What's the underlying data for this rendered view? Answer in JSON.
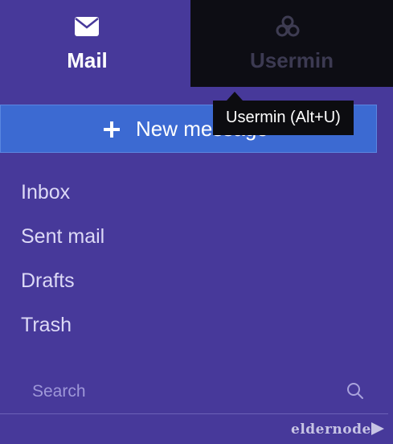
{
  "tabs": {
    "mail": {
      "label": "Mail",
      "icon": "envelope-icon"
    },
    "usermin": {
      "label": "Usermin",
      "icon": "usermin-logo-icon"
    }
  },
  "tooltip": {
    "text": "Usermin (Alt+U)"
  },
  "new_message": {
    "label": "New message",
    "icon": "plus-icon"
  },
  "folders": [
    {
      "label": "Inbox"
    },
    {
      "label": "Sent mail"
    },
    {
      "label": "Drafts"
    },
    {
      "label": "Trash"
    }
  ],
  "search": {
    "placeholder": "Search",
    "value": "",
    "icon": "search-icon"
  },
  "watermark": {
    "text": "eldernode"
  },
  "colors": {
    "sidebar_bg": "#47399a",
    "active_tab_bg": "#0d0d14",
    "button_bg": "#3c6ad2",
    "tooltip_bg": "#0c0c10"
  }
}
